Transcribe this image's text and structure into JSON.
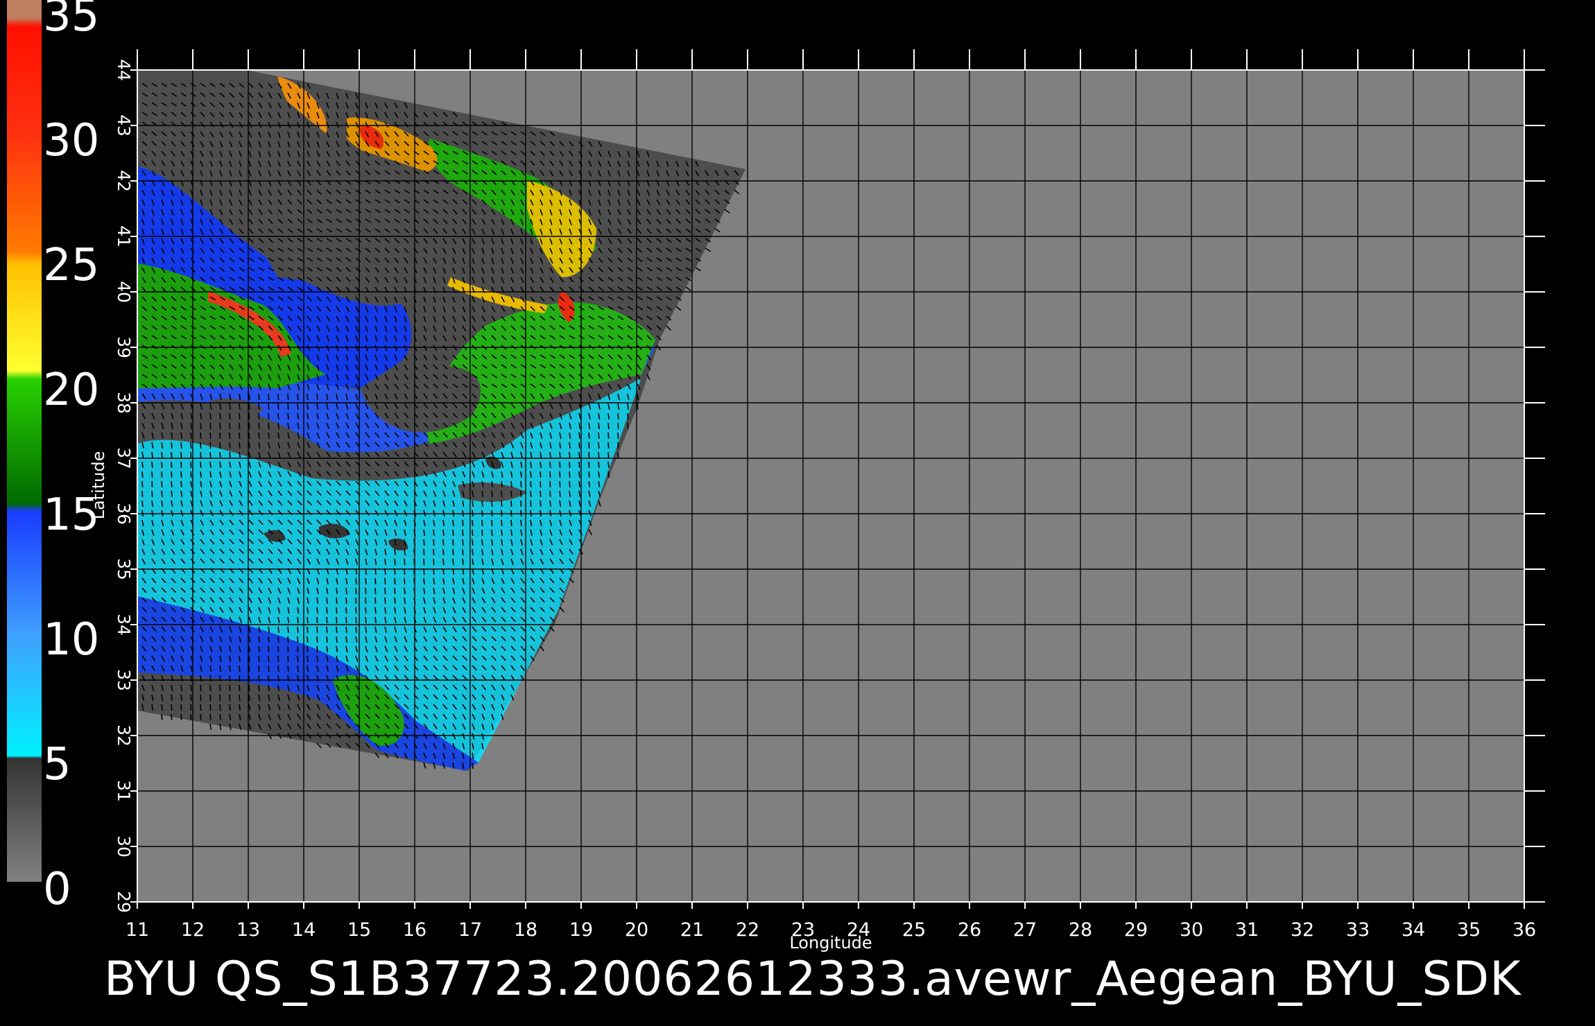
{
  "map": {
    "colorbar": {
      "labels": [
        "35",
        "30",
        "25",
        "20",
        "15",
        "10",
        "5",
        "0"
      ],
      "min": 0,
      "max": 35
    },
    "x_axis": {
      "title": "Longitude",
      "ticks": [
        "11",
        "12",
        "13",
        "14",
        "15",
        "16",
        "17",
        "18",
        "19",
        "20",
        "21",
        "22",
        "23",
        "24",
        "25",
        "26",
        "27",
        "28",
        "29",
        "30",
        "31",
        "32",
        "33",
        "34",
        "35",
        "36"
      ],
      "range": [
        11,
        36
      ]
    },
    "y_axis": {
      "title": "Latitude",
      "ticks": [
        "29",
        "30",
        "31",
        "32",
        "33",
        "34",
        "35",
        "36",
        "37",
        "38",
        "39",
        "40",
        "41",
        "42",
        "43",
        "44"
      ],
      "range": [
        29,
        44
      ]
    },
    "caption": "BYU  QS_S1B37723.20062612333.avewr_Aegean_BYU_SDK"
  },
  "colors": {
    "background": "#000000",
    "no_data": "#808080",
    "land_in_swath": "#555555",
    "grid": "#000000",
    "calm": "#00e5ff",
    "moderate": "#1f4dff",
    "fresh": "#17b000",
    "strong": "#ffe000",
    "gale": "#ff2200"
  }
}
